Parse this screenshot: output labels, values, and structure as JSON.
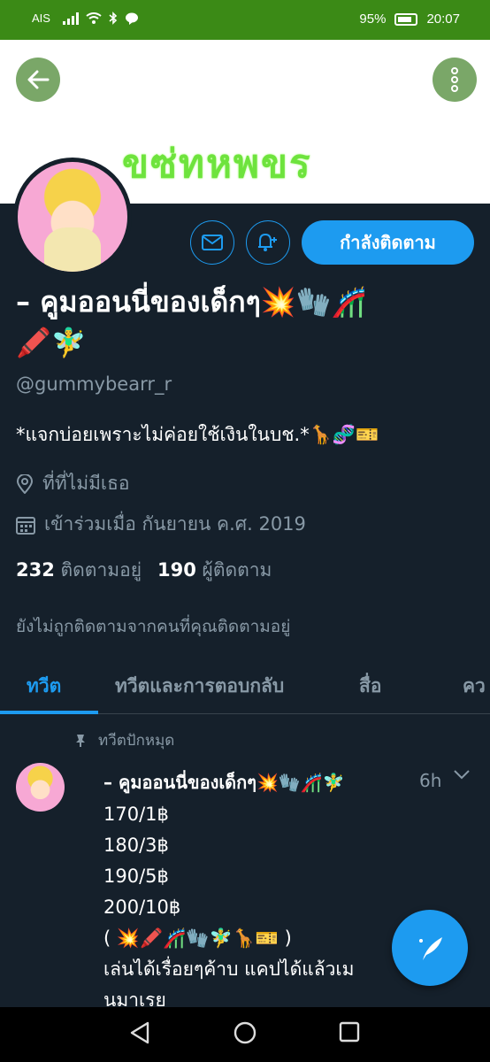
{
  "status_bar": {
    "carrier": "AIS",
    "battery": "95%",
    "time": "20:07"
  },
  "banner": {
    "text": "ขซ่ทหพขร"
  },
  "profile": {
    "follow_label": "กำลังติดตาม",
    "name": "– คูมออนนี่ของเด็กๆ💥🧤🎢\n🖍️🧚‍♂️",
    "handle": "@gummybearr_r",
    "bio": "*แจกบ่อยเพราะไม่ค่อยใช้เงินในบช.*🦒🧬🎫",
    "location": "ที่ที่ไม่มีเธอ",
    "joined": "เข้าร่วมเมื่อ กันยายน ค.ศ. 2019",
    "following_count": "232",
    "following_label": "ติดตามอยู่",
    "followers_count": "190",
    "followers_label": "ผู้ติดตาม",
    "not_followed": "ยังไม่ถูกติดตามจากคนที่คุณติดตามอยู่"
  },
  "tabs": [
    {
      "label": "ทวีต"
    },
    {
      "label": "ทวีตและการตอบกลับ"
    },
    {
      "label": "สื่อ"
    },
    {
      "label": "คว"
    }
  ],
  "tweet": {
    "pinned_label": "ทวีตปักหมุด",
    "author": "– คูมออนนี่ของเด็กๆ💥🧤🎢🧚‍♂️",
    "time": "6h",
    "body": "170/1฿\n180/3฿\n190/5฿\n200/10฿\n( 💥🖍️🎢🧤🧚‍♂️🦒🎫 )\nเล่นได้เรื่อยๆค้าบ แคปได้แล้วเม\nนมาเรย"
  },
  "icons": {
    "back": "back-arrow-icon",
    "more": "more-vertical-icon",
    "message": "mail-icon",
    "notify": "bell-plus-icon",
    "location": "location-pin-icon",
    "calendar": "calendar-icon",
    "pin": "pin-icon",
    "compose": "compose-tweet-icon"
  },
  "colors": {
    "accent": "#1d9bf0",
    "background": "#15202b",
    "status_bar": "#3b8a16"
  }
}
